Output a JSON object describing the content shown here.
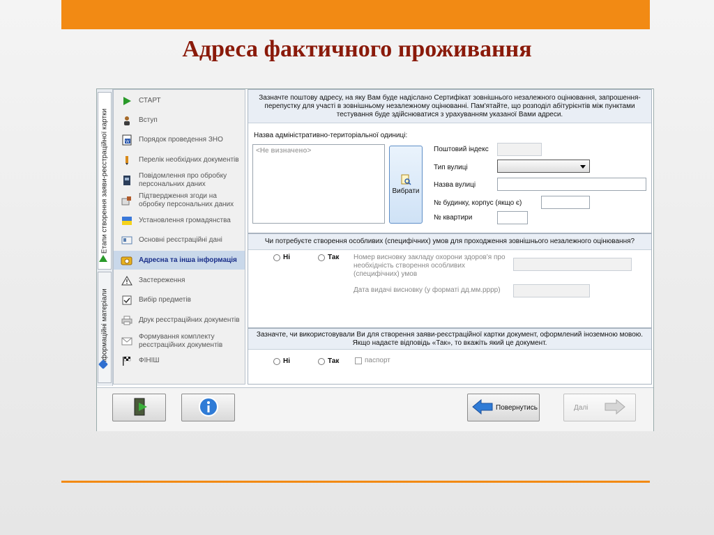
{
  "slide": {
    "title": "Адреса фактичного проживання"
  },
  "tabs": [
    {
      "label": "Етапи створення заяви-реєстраційної картки"
    },
    {
      "label": "Інформаційні матеріали"
    }
  ],
  "nav": {
    "items": [
      {
        "label": "СТАРТ",
        "icon": "play-icon"
      },
      {
        "label": "Вступ",
        "icon": "person-icon"
      },
      {
        "label": "Порядок проведення ЗНО",
        "icon": "word-doc-icon"
      },
      {
        "label": "Перелік необхідних документів",
        "icon": "pencil-icon"
      },
      {
        "label": "Повідомлення про обробку персональних даних",
        "icon": "book-icon"
      },
      {
        "label": "Підтвердження згоди на обробку персональних даних",
        "icon": "stamp-icon"
      },
      {
        "label": "Установлення громадянства",
        "icon": "flag-icon"
      },
      {
        "label": "Основні реєстраційні дані",
        "icon": "card-icon"
      },
      {
        "label": "Адресна та інша інформація",
        "icon": "envelope-icon"
      },
      {
        "label": "Застереження",
        "icon": "warning-icon"
      },
      {
        "label": "Вибір предметів",
        "icon": "checklist-icon"
      },
      {
        "label": "Друк реєстраційних документів",
        "icon": "printer-icon"
      },
      {
        "label": "Формування комплекту реєстраційних документів",
        "icon": "mail-icon"
      },
      {
        "label": "ФІНІШ",
        "icon": "finish-flag-icon"
      }
    ],
    "active_index": 8
  },
  "address": {
    "instructions": "Зазначте поштову адресу, на яку Вам буде надіслано Сертифікат зовнішнього незалежного оцінювання, запрошення-перепустку для участі в зовнішньому незалежному оцінюванні.   Пам'ятайте, що розподіл абітурієнтів між пунктами тестування буде здійснюватися з урахуванням указаної Вами адреси.",
    "admin_unit_label": "Назва адміністративно-територіальної одиниці:",
    "admin_unit_value": "<Не визначено>",
    "choose_button": "Вибрати",
    "postal_code_label": "Поштовий індекс",
    "street_type_label": "Тип вулиці",
    "street_name_label": "Назва вулиці",
    "house_label": "№ будинку, корпус (якщо є)",
    "apartment_label": "№ квартири"
  },
  "special": {
    "question": "Чи потребуєте створення особливих (специфічних) умов для проходження зовнішнього незалежного оцінювання?",
    "no": "Ні",
    "yes": "Так",
    "conclusion_label": "Номер висновку закладу охорони здоров'я про необхідність створення особливих (специфічних) умов",
    "date_label": "Дата видачі висновку (у форматі дд.мм.рррр)"
  },
  "document": {
    "question": "Зазначте, чи використовували Ви для створення заяви-реєстраційної картки документ, оформлений іноземною мовою. Якщо надаєте відповідь «Так», то вкажіть який це документ.",
    "no": "Ні",
    "yes": "Так",
    "passport": "паспорт"
  },
  "footer": {
    "back": "Повернутись",
    "next": "Далі"
  },
  "colors": {
    "accent": "#f28a14",
    "title": "#8a1a0a"
  }
}
